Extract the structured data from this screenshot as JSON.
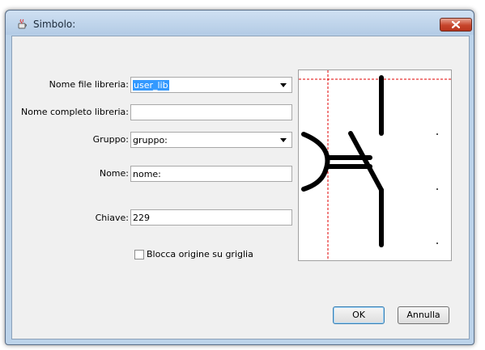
{
  "window": {
    "title": "Simbolo:",
    "app_icon": "java-cup-icon",
    "close_icon": "close-icon"
  },
  "form": {
    "library_file_label": "Nome file libreria:",
    "library_file_value": "user_lib",
    "library_full_name_label": "Nome completo libreria:",
    "library_full_name_value": "",
    "group_label": "Gruppo:",
    "group_value": "gruppo:",
    "name_label": "Nome:",
    "name_value": "nome:",
    "key_label": "Chiave:",
    "key_value": "229",
    "lock_origin_label": "Blocca origine su griglia",
    "lock_origin_checked": false
  },
  "buttons": {
    "ok": "OK",
    "cancel": "Annulla"
  },
  "colors": {
    "selection": "#3399ff",
    "origin_guides": "#e00000",
    "close_button": "#c7452c"
  }
}
